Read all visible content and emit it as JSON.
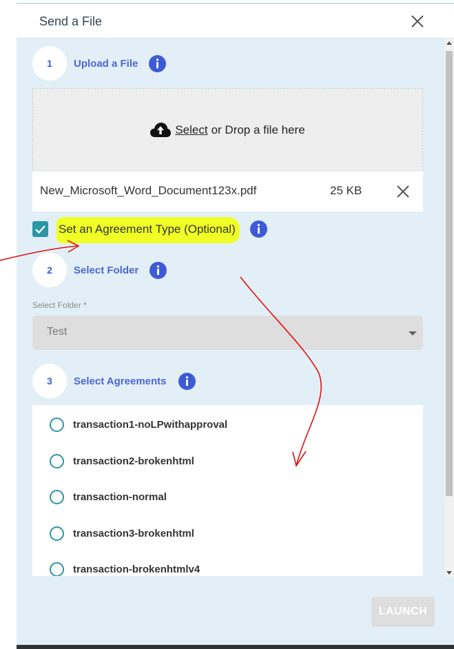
{
  "dialog": {
    "title": "Send a File"
  },
  "steps": {
    "upload": {
      "number": "1",
      "label": "Upload a File"
    },
    "folder": {
      "number": "2",
      "label": "Select Folder"
    },
    "agreements": {
      "number": "3",
      "label": "Select Agreements"
    }
  },
  "dropzone": {
    "select_link": "Select",
    "text": "or Drop a file here"
  },
  "file": {
    "name": "New_Microsoft_Word_Document123x.pdf",
    "size": "25 KB"
  },
  "agreement_type": {
    "label": "Set an Agreement Type (Optional)",
    "checked": true
  },
  "folder_field": {
    "label": "Select Folder *",
    "value": "Test"
  },
  "agreement_list": [
    {
      "label": "transaction1-noLPwithapproval"
    },
    {
      "label": "transaction2-brokenhtml"
    },
    {
      "label": "transaction-normal"
    },
    {
      "label": "transaction3-brokenhtml"
    },
    {
      "label": "transaction-brokenhtmlv4"
    }
  ],
  "actions": {
    "launch_label": "LAUNCH"
  },
  "colors": {
    "accent_blue": "#4a66d4",
    "teal": "#2a96a6",
    "highlight": "#f0ff24",
    "annotation_red": "#e01010"
  }
}
